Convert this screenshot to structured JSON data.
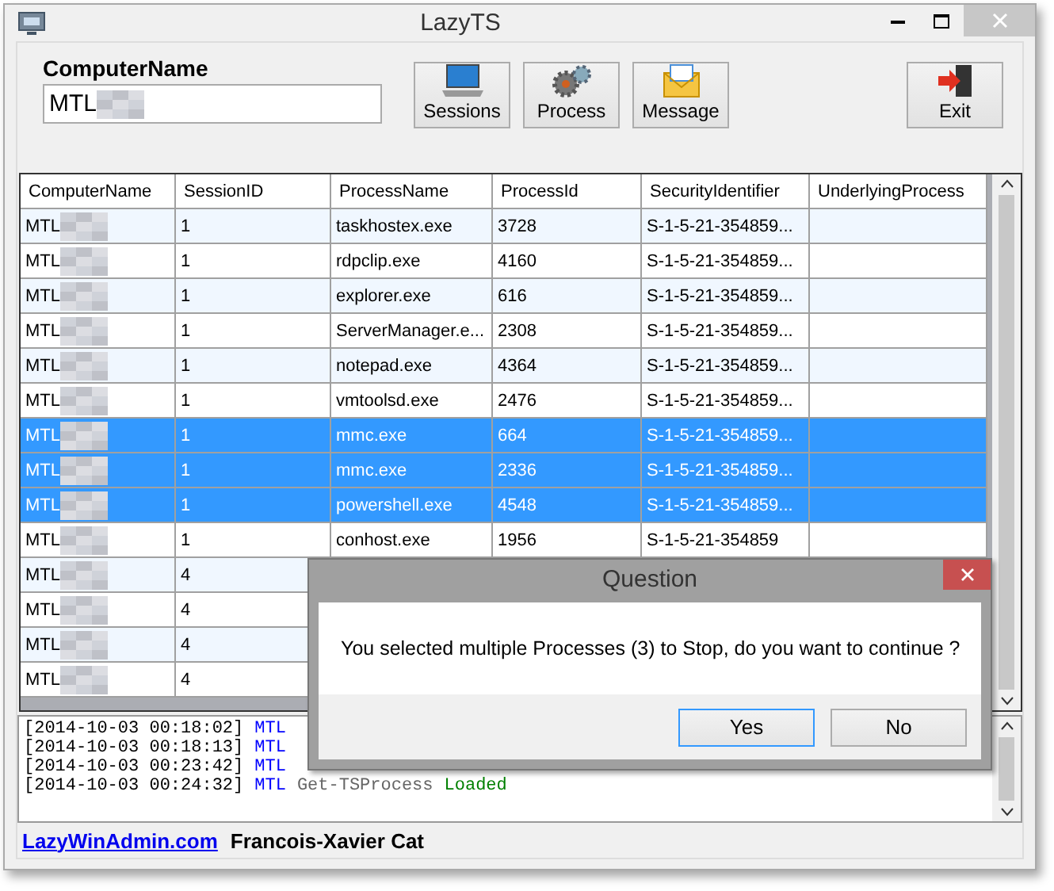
{
  "window": {
    "title": "LazyTS"
  },
  "computer_name": {
    "label": "ComputerName",
    "value": "MTL"
  },
  "toolbar": [
    {
      "kind": "sessions",
      "label": "Sessions"
    },
    {
      "kind": "process",
      "label": "Process"
    },
    {
      "kind": "message",
      "label": "Message"
    }
  ],
  "exit_button": {
    "label": "Exit"
  },
  "table": {
    "columns": [
      "ComputerName",
      "SessionID",
      "ProcessName",
      "ProcessId",
      "SecurityIdentifier",
      "UnderlyingProcess"
    ],
    "rows": [
      {
        "selected": false,
        "cells": [
          "MTL",
          "1",
          "taskhostex.exe",
          "3728",
          "S-1-5-21-354859..."
        ]
      },
      {
        "selected": false,
        "cells": [
          "MTL",
          "1",
          "rdpclip.exe",
          "4160",
          "S-1-5-21-354859..."
        ]
      },
      {
        "selected": false,
        "cells": [
          "MTL",
          "1",
          "explorer.exe",
          "616",
          "S-1-5-21-354859..."
        ]
      },
      {
        "selected": false,
        "cells": [
          "MTL",
          "1",
          "ServerManager.e...",
          "2308",
          "S-1-5-21-354859..."
        ]
      },
      {
        "selected": false,
        "cells": [
          "MTL",
          "1",
          "notepad.exe",
          "4364",
          "S-1-5-21-354859..."
        ]
      },
      {
        "selected": false,
        "cells": [
          "MTL",
          "1",
          "vmtoolsd.exe",
          "2476",
          "S-1-5-21-354859..."
        ]
      },
      {
        "selected": true,
        "cells": [
          "MTL",
          "1",
          "mmc.exe",
          "664",
          "S-1-5-21-354859..."
        ]
      },
      {
        "selected": true,
        "cells": [
          "MTL",
          "1",
          "mmc.exe",
          "2336",
          "S-1-5-21-354859..."
        ]
      },
      {
        "selected": true,
        "cells": [
          "MTL",
          "1",
          "powershell.exe",
          "4548",
          "S-1-5-21-354859..."
        ]
      },
      {
        "selected": false,
        "cells": [
          "MTL",
          "1",
          "conhost.exe",
          "1956",
          "S-1-5-21-354859"
        ]
      },
      {
        "selected": false,
        "cells": [
          "MTL",
          "4"
        ]
      },
      {
        "selected": false,
        "cells": [
          "MTL",
          "4"
        ]
      },
      {
        "selected": false,
        "cells": [
          "MTL",
          "4"
        ]
      },
      {
        "selected": false,
        "cells": [
          "MTL",
          "4"
        ]
      }
    ]
  },
  "log": [
    {
      "time": "[2014-10-03 00:18:02]",
      "host": "MTL"
    },
    {
      "time": "[2014-10-03 00:18:13]",
      "host": "MTL"
    },
    {
      "time": "[2014-10-03 00:23:42]",
      "host": "MTL"
    },
    {
      "time": "[2014-10-03 00:24:32]",
      "host": "MTL",
      "command": "Get-TSProcess",
      "status": "Loaded"
    }
  ],
  "status_bar": {
    "link": "LazyWinAdmin.com",
    "author": "Francois-Xavier Cat"
  },
  "dialog": {
    "title": "Question",
    "message": "You selected multiple Processes (3) to Stop, do you want to continue ?",
    "buttons": [
      {
        "label": "Yes",
        "default": true
      },
      {
        "label": "No",
        "default": false
      }
    ]
  }
}
